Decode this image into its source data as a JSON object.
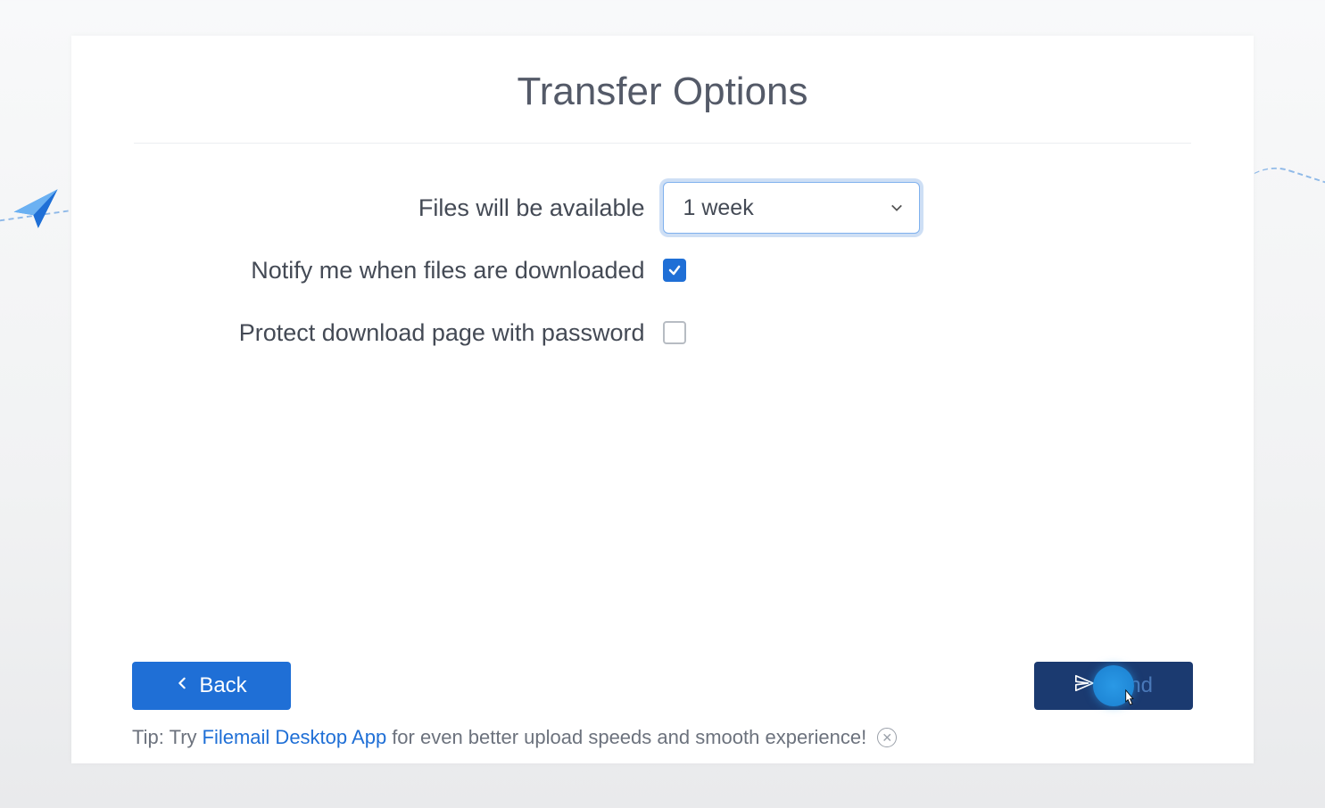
{
  "title": "Transfer Options",
  "form": {
    "availability": {
      "label": "Files will be available",
      "value": "1 week"
    },
    "notify": {
      "label": "Notify me when files are downloaded",
      "checked": true
    },
    "password": {
      "label": "Protect download page with password",
      "checked": false
    }
  },
  "buttons": {
    "back": "Back",
    "send": "Send"
  },
  "tip": {
    "prefix": "Tip: Try ",
    "link": "Filemail Desktop App",
    "suffix": " for even better upload speeds and smooth experience!"
  }
}
